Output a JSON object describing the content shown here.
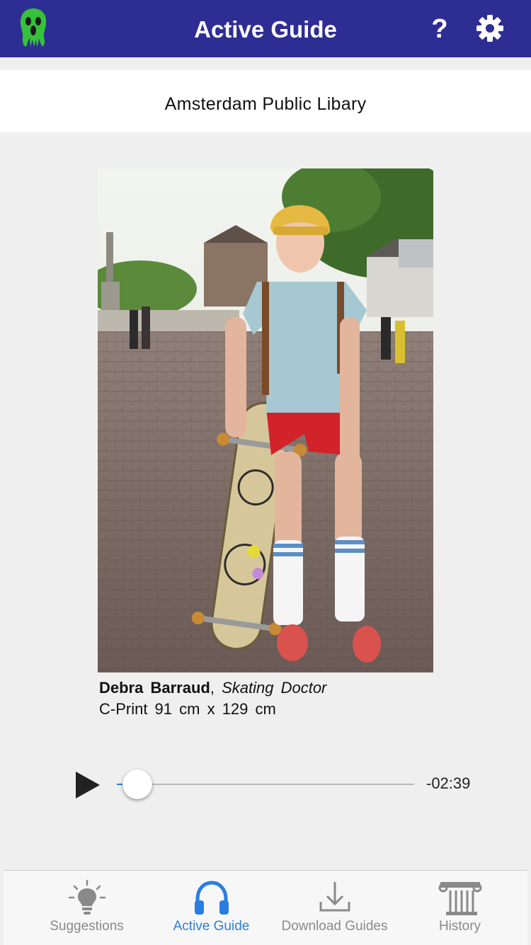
{
  "header": {
    "title": "Active Guide",
    "help_label": "?",
    "logo_icon": "scream-face-icon",
    "settings_icon": "gear-icon"
  },
  "venue": {
    "name": "Amsterdam Public Libary"
  },
  "artwork": {
    "artist": "Debra Barraud",
    "separator": ",",
    "title": "Skating Doctor",
    "details": "C-Print 91 cm x 129 cm"
  },
  "player": {
    "play_icon": "play-icon",
    "progress": 0.02,
    "time_remaining": "-02:39"
  },
  "tabs": [
    {
      "label": "Suggestions",
      "icon": "lightbulb-icon",
      "active": false
    },
    {
      "label": "Active Guide",
      "icon": "headphones-icon",
      "active": true
    },
    {
      "label": "Download Guides",
      "icon": "download-icon",
      "active": false
    },
    {
      "label": "History",
      "icon": "column-icon",
      "active": false
    }
  ],
  "colors": {
    "navbar": "#2e2d94",
    "accent": "#2a7de1",
    "logo_green": "#37c03a",
    "inactive_tab": "#8a8a8a"
  }
}
